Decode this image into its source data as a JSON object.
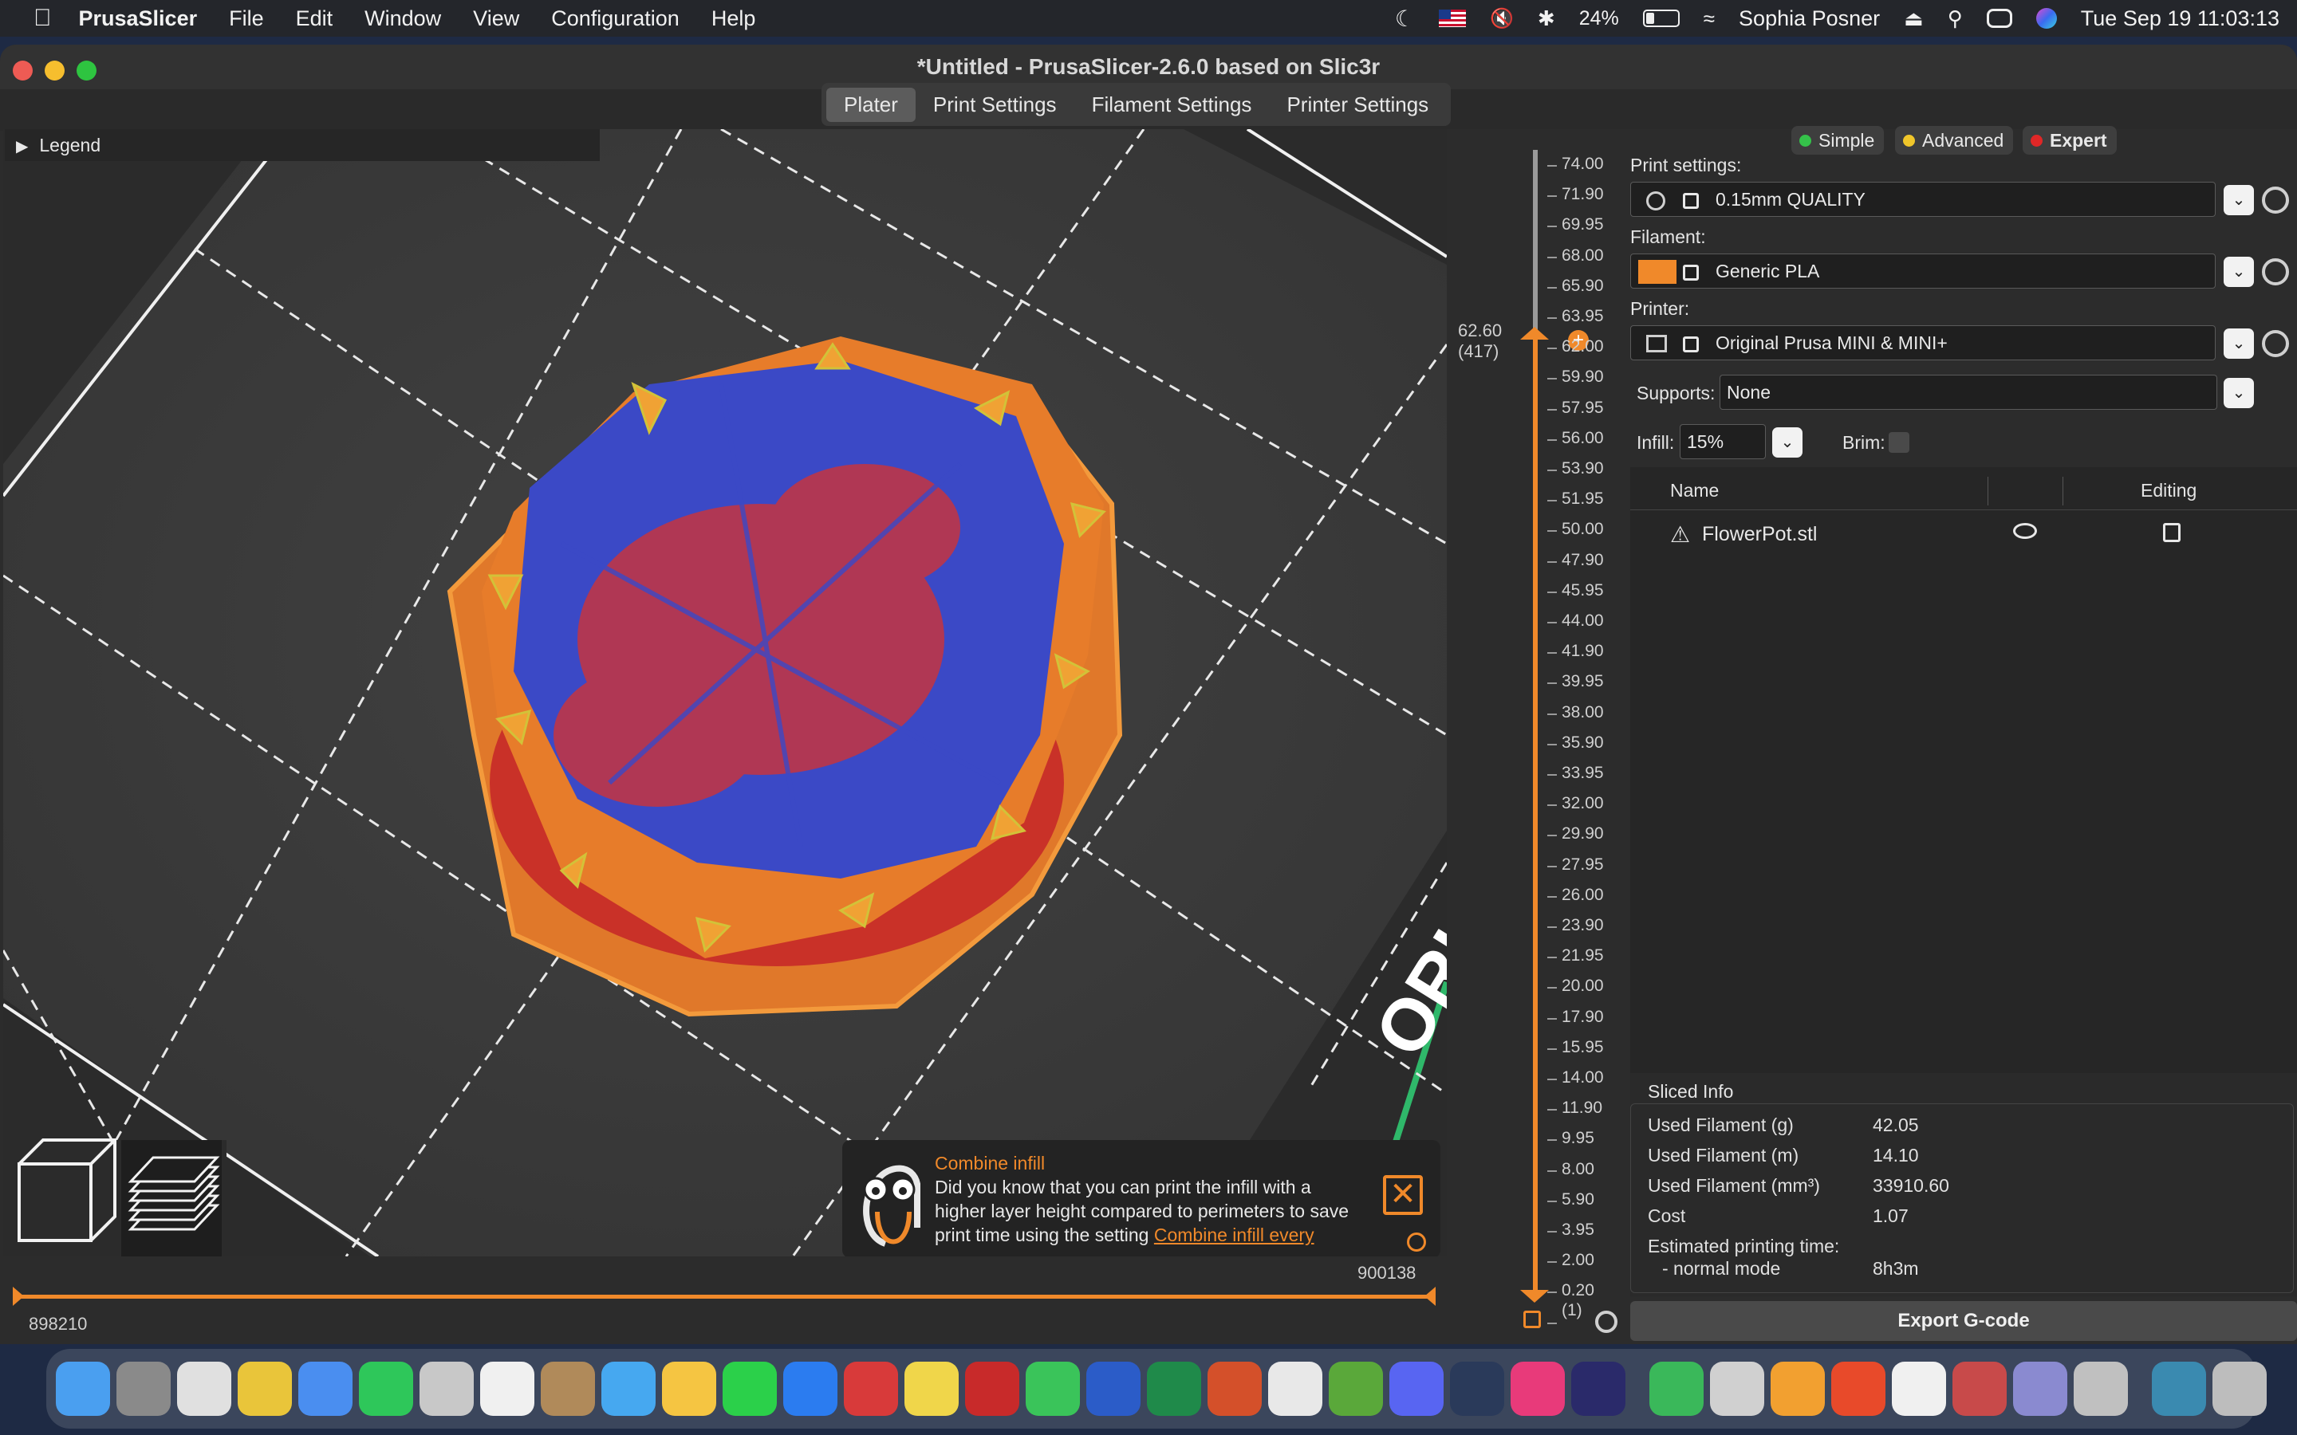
{
  "menubar": {
    "app_name": "PrusaSlicer",
    "items": [
      "File",
      "Edit",
      "Window",
      "View",
      "Configuration",
      "Help"
    ],
    "battery": "24%",
    "user": "Sophia Posner",
    "datetime": "Tue Sep 19  11:03:13"
  },
  "window": {
    "title": "*Untitled - PrusaSlicer-2.6.0 based on Slic3r",
    "tabs": [
      "Plater",
      "Print Settings",
      "Filament Settings",
      "Printer Settings"
    ],
    "active_tab": "Plater"
  },
  "viewport": {
    "legend_label": "Legend",
    "bed_text": "ORIGI",
    "colors": {
      "perimeter": "#f0892a",
      "infill": "#3b49c6",
      "solid_infill": "#d8322e",
      "bed": "#3b3b3b"
    }
  },
  "layer_slider": {
    "current_value": "62.60",
    "current_layer": "(417)",
    "ticks": [
      "74.00",
      "71.90",
      "69.95",
      "68.00",
      "65.90",
      "63.95",
      "62.00",
      "59.90",
      "57.95",
      "56.00",
      "53.90",
      "51.95",
      "50.00",
      "47.90",
      "45.95",
      "44.00",
      "41.90",
      "39.95",
      "38.00",
      "35.90",
      "33.95",
      "32.00",
      "29.90",
      "27.95",
      "26.00",
      "23.90",
      "21.95",
      "20.00",
      "17.90",
      "15.95",
      "14.00",
      "11.90",
      "9.95",
      "8.00",
      "5.90",
      "3.95",
      "2.00",
      "0.20",
      "(1)"
    ]
  },
  "hslider": {
    "left_value": "898210",
    "right_value": "900138"
  },
  "tip": {
    "title": "Combine infill",
    "text_line1": "Did you know that you can print the infill with a",
    "text_line2": "higher layer height compared to perimeters to save",
    "text_line3": "print time using the setting ",
    "link": "Combine infill every"
  },
  "panel": {
    "modes": [
      "Simple",
      "Advanced",
      "Expert"
    ],
    "mode_colors": [
      "#35c24a",
      "#f0c62a",
      "#e02727"
    ],
    "print_settings_label": "Print settings:",
    "print_settings_value": "0.15mm QUALITY",
    "filament_label": "Filament:",
    "filament_value": "Generic PLA",
    "filament_color": "#f0892a",
    "printer_label": "Printer:",
    "printer_value": "Original Prusa MINI & MINI+",
    "supports_label": "Supports:",
    "supports_value": "None",
    "infill_label": "Infill:",
    "infill_value": "15%",
    "brim_label": "Brim:",
    "list_headers": [
      "Name",
      "Editing"
    ],
    "objects": [
      {
        "name": "FlowerPot.stl"
      }
    ]
  },
  "sliced_info": {
    "title": "Sliced Info",
    "rows": [
      {
        "label": "Used Filament (g)",
        "value": "42.05"
      },
      {
        "label": "Used Filament (m)",
        "value": "14.10"
      },
      {
        "label": "Used Filament (mm³)",
        "value": "33910.60"
      },
      {
        "label": "Cost",
        "value": "1.07"
      },
      {
        "label": "Estimated printing time:",
        "value": ""
      },
      {
        "label": "- normal mode",
        "value": "8h3m"
      }
    ],
    "export_label": "Export G-code"
  },
  "dock": {
    "icon_colors": [
      "#4a9ff0",
      "#8a8a8a",
      "#e0e0e0",
      "#e9c53a",
      "#4a8ef0",
      "#2ec75a",
      "#c8c8c8",
      "#f0f0f0",
      "#b08a5a",
      "#46a8f0",
      "#f5c542",
      "#2bd04a",
      "#2b7cf0",
      "#d83a3a",
      "#f0d64a",
      "#c82a2a",
      "#3ac45a",
      "#2b5cc8",
      "#1f8a4a",
      "#d4502a",
      "#e8e8e8",
      "#5aa83a",
      "#5865f2",
      "#2a3a5a",
      "#e83a7a",
      "#2a2a6a",
      "#3ab85a",
      "#d0d0d0",
      "#f2a030",
      "#e84a2a",
      "#f0f0f0",
      "#c84a4a",
      "#8a8ad0",
      "#c0c0c0",
      "#3a8ab0",
      "#bdbdbd"
    ]
  }
}
